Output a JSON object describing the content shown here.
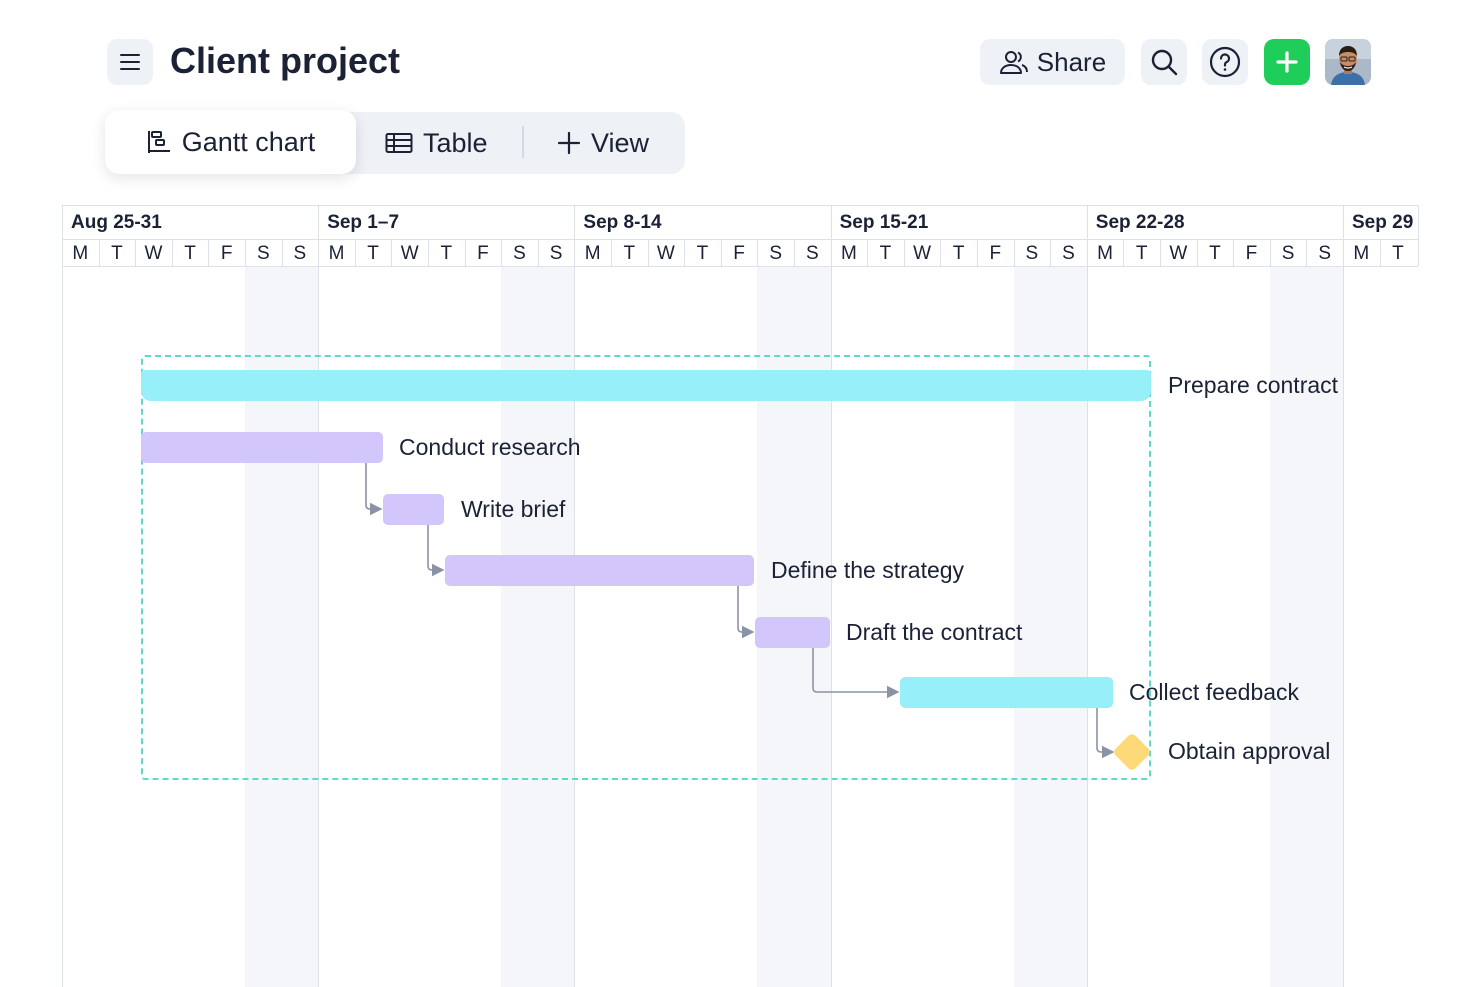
{
  "header": {
    "title": "Client project",
    "share_label": "Share",
    "icons": {
      "menu": "hamburger-icon",
      "share": "users-icon",
      "search": "search-icon",
      "help": "help-icon",
      "add": "plus-icon"
    }
  },
  "tabs": [
    {
      "label": "Gantt chart",
      "icon": "gantt-icon",
      "active": true
    },
    {
      "label": "Table",
      "icon": "table-icon",
      "active": false
    },
    {
      "label": "View",
      "icon": "plus-icon",
      "active": false
    }
  ],
  "timeline": {
    "weeks": [
      "Aug 25-31",
      "Sep 1–7",
      "Sep 8-14",
      "Sep 15-21",
      "Sep 22-28",
      "Sep 29"
    ],
    "days": [
      "M",
      "T",
      "W",
      "T",
      "F",
      "S",
      "S",
      "M",
      "T",
      "W",
      "T",
      "F",
      "S",
      "S",
      "M",
      "T",
      "W",
      "T",
      "F",
      "S",
      "S",
      "M",
      "T",
      "W",
      "T",
      "F",
      "S",
      "S",
      "M",
      "T",
      "W",
      "T",
      "F",
      "S",
      "S",
      "M",
      "T"
    ]
  },
  "tasks": [
    {
      "name": "Prepare contract",
      "type": "group"
    },
    {
      "name": "Conduct research",
      "type": "task"
    },
    {
      "name": "Write brief",
      "type": "task"
    },
    {
      "name": "Define the strategy",
      "type": "task"
    },
    {
      "name": "Draft the contract",
      "type": "task"
    },
    {
      "name": "Collect feedback",
      "type": "task"
    },
    {
      "name": "Obtain approval",
      "type": "milestone"
    }
  ],
  "colors": {
    "accent_green": "#1fce5a",
    "task_purple": "#d2c6fb",
    "task_cyan": "#97f0f9",
    "milestone_yellow": "#fdd978",
    "group_border": "#5ed9cc"
  }
}
